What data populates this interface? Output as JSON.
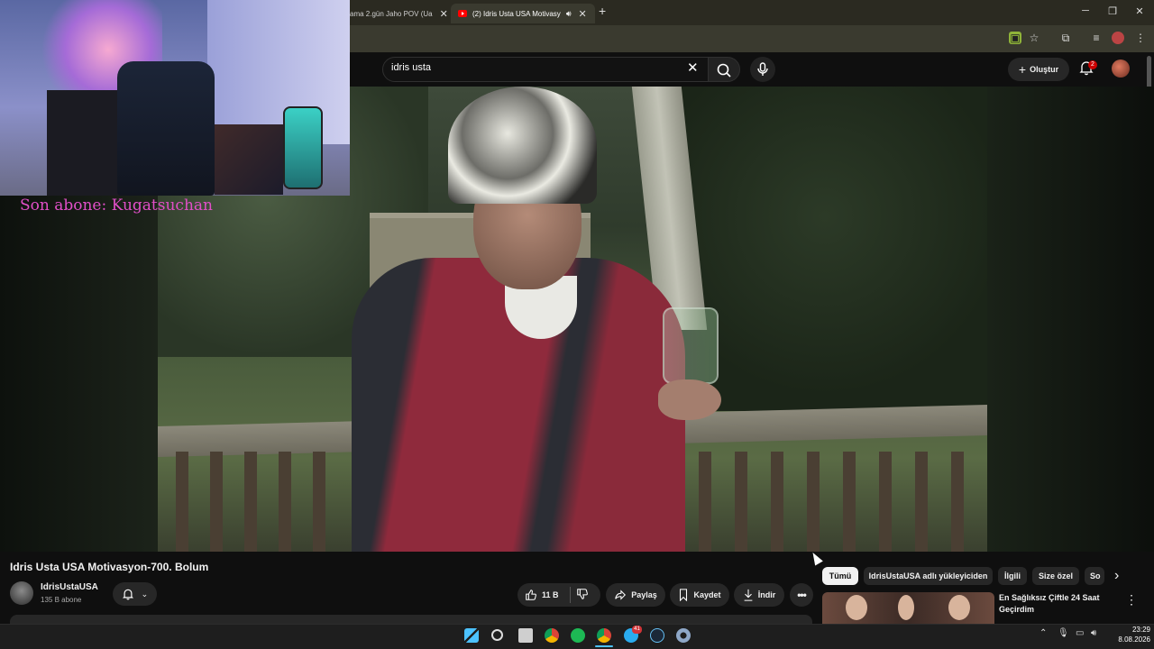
{
  "browser": {
    "tabs": [
      {
        "label": "ama 2.gün Jaho POV (Ua"
      },
      {
        "label": "(2) Idris Usta USA Motivasy"
      }
    ],
    "new_tab_icon": "plus-icon",
    "window_controls": [
      "minimize-icon",
      "restore-icon",
      "close-icon"
    ]
  },
  "header": {
    "search_value": "idris usta",
    "create_label": "Oluştur",
    "notification_count": "2"
  },
  "overlay": {
    "last_subscriber": "Son abone: Kugatsuchan"
  },
  "video": {
    "title": "Idris Usta USA Motivasyon-700. Bolum",
    "channel_name": "IdrisUstaUSA",
    "subscriber_count": "135 B abone",
    "like_count": "11 B",
    "share_label": "Paylaş",
    "save_label": "Kaydet",
    "download_label": "İndir"
  },
  "chips": [
    {
      "label": "Tümü",
      "active": true
    },
    {
      "label": "IdrisUstaUSA adlı yükleyiciden"
    },
    {
      "label": "İlgili"
    },
    {
      "label": "Size özel"
    },
    {
      "label": "So"
    }
  ],
  "recommended": [
    {
      "title": "En Sağlıksız Çiftle 24 Saat Geçirdim"
    }
  ],
  "taskbar": {
    "telegram_badge": "41",
    "time": "23:29",
    "date": "8.08.2026"
  },
  "colors": {
    "overlay_text": "#e14fc8",
    "yt_red": "#ff0000",
    "accent_blue": "#4cc2ff"
  }
}
